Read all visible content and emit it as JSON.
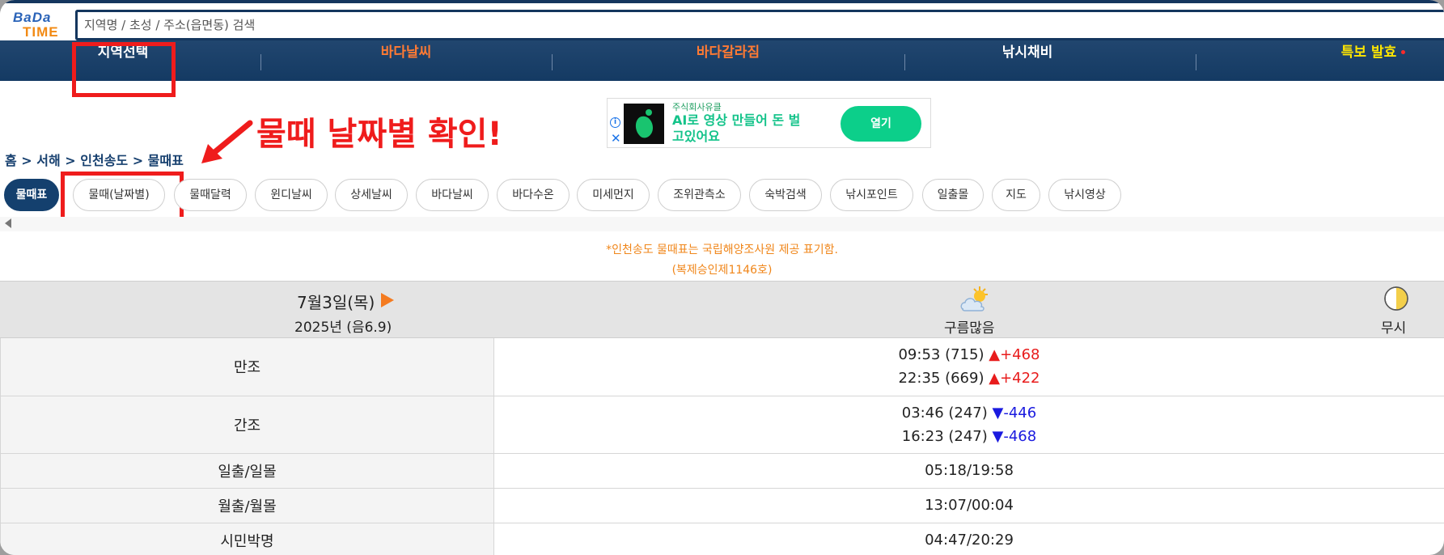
{
  "logo": {
    "line1": "BaDa",
    "line2": "TIME"
  },
  "search": {
    "placeholder": "지역명 / 초성 / 주소(읍면동) 검색"
  },
  "nav": {
    "items": [
      {
        "label": "지역선택",
        "color": "#ffffff"
      },
      {
        "label": "바다날씨",
        "color": "#ff7a33"
      },
      {
        "label": "바다갈라짐",
        "color": "#ff7a33"
      },
      {
        "label": "낚시채비",
        "color": "#ffffff"
      },
      {
        "label": "특보 발효",
        "color": "#ffe600"
      }
    ]
  },
  "annotation": {
    "text": "물때 날짜별 확인!",
    "color": "#ef1c1c"
  },
  "ad": {
    "advertiser": "주식회사유클",
    "headline": "AI로 영상 만들어 돈 벌고있어요",
    "button": "열기",
    "info_icon": "info-icon",
    "close_icon": "close-icon"
  },
  "breadcrumb": "홈 > 서해 > 인천송도 > 물때표",
  "tabs": [
    {
      "label": "물때표",
      "active": true
    },
    {
      "label": "물때(날짜별)",
      "active": false
    },
    {
      "label": "물때달력",
      "active": false
    },
    {
      "label": "윈디날씨",
      "active": false
    },
    {
      "label": "상세날씨",
      "active": false
    },
    {
      "label": "바다날씨",
      "active": false
    },
    {
      "label": "바다수온",
      "active": false
    },
    {
      "label": "미세먼지",
      "active": false
    },
    {
      "label": "조위관측소",
      "active": false
    },
    {
      "label": "숙박검색",
      "active": false
    },
    {
      "label": "낚시포인트",
      "active": false
    },
    {
      "label": "일출몰",
      "active": false
    },
    {
      "label": "지도",
      "active": false
    },
    {
      "label": "낚시영상",
      "active": false
    }
  ],
  "notice": {
    "line1": "*인천송도 물때표는 국립해양조사원 제공 표기함.",
    "line2": "(복제승인제1146호)"
  },
  "day": {
    "date": "7월3일(목)",
    "year_lunar": "2025년 (음6.9)",
    "weather": "구름많음",
    "weather_icon": "partly-cloudy-icon",
    "moon_label": "무시",
    "moon_icon": "half-moon-icon"
  },
  "table": {
    "high_tide": {
      "label": "만조",
      "entries": [
        {
          "time_level": "09:53 (715)",
          "arrow": "▲",
          "change": "+468"
        },
        {
          "time_level": "22:35 (669)",
          "arrow": "▲",
          "change": "+422"
        }
      ]
    },
    "low_tide": {
      "label": "간조",
      "entries": [
        {
          "time_level": "03:46 (247)",
          "arrow": "▼",
          "change": "-446"
        },
        {
          "time_level": "16:23 (247)",
          "arrow": "▼",
          "change": "-468"
        }
      ]
    },
    "sunrise_sunset": {
      "label": "일출/일몰",
      "value": "05:18/19:58"
    },
    "moonrise_moonset": {
      "label": "월출/월몰",
      "value": "13:07/00:04"
    },
    "civil_twilight": {
      "label": "시민박명",
      "value": "04:47/20:29"
    }
  }
}
